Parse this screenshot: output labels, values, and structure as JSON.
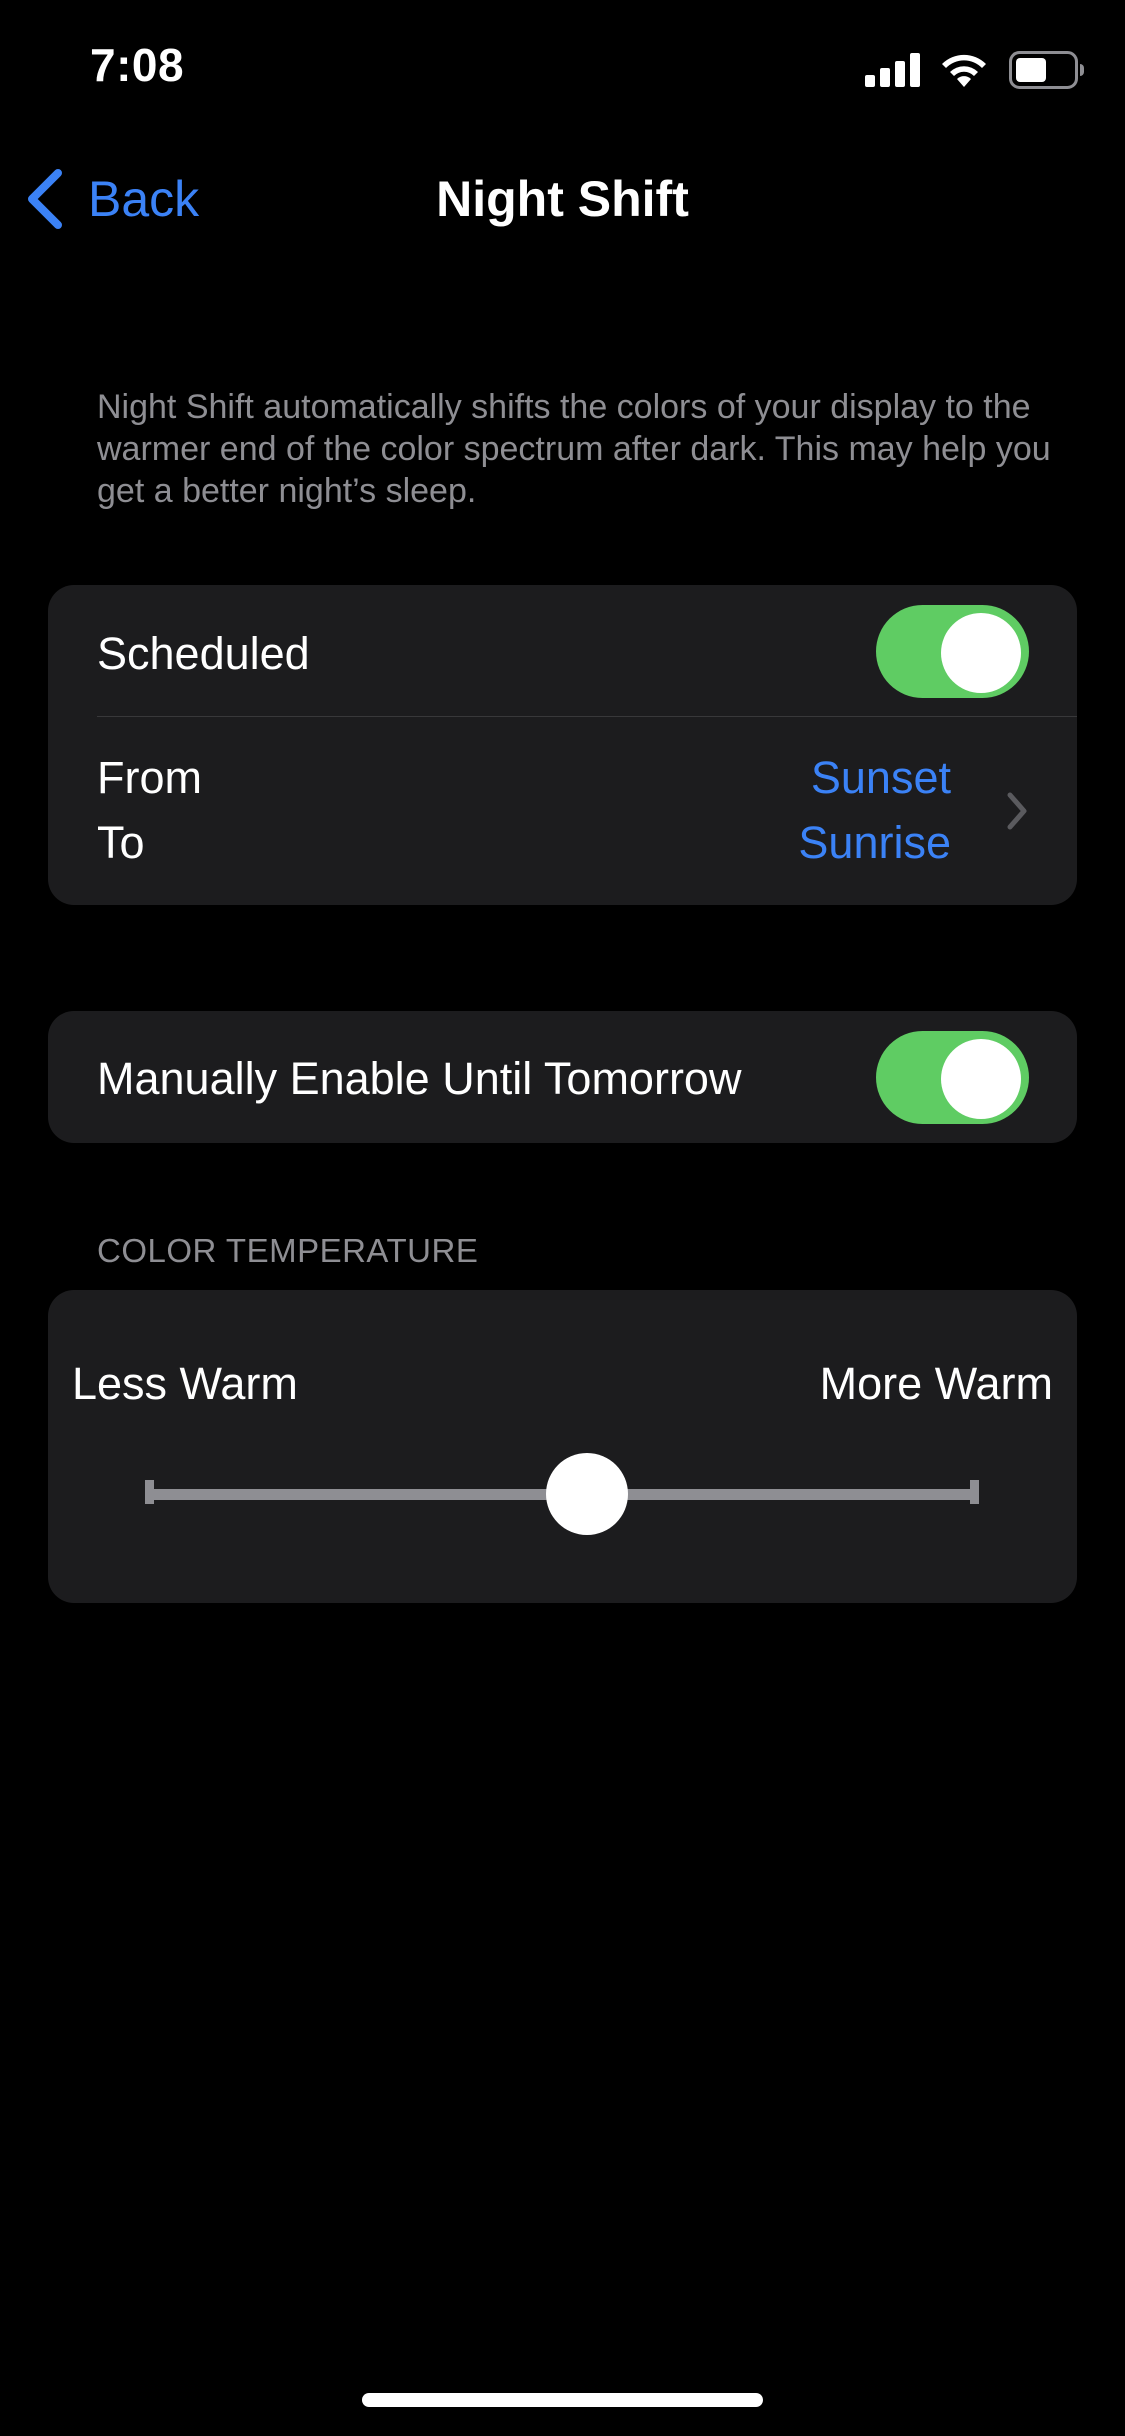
{
  "status_bar": {
    "time": "7:08",
    "icons": [
      "signal-icon",
      "wifi-icon",
      "battery-icon"
    ]
  },
  "nav": {
    "back_label": "Back",
    "title": "Night Shift"
  },
  "description": "Night Shift automatically shifts the colors of your display to the warmer end of the color spectrum after dark. This may help you get a better night’s sleep.",
  "schedule": {
    "scheduled_label": "Scheduled",
    "scheduled_on": true,
    "from_label": "From",
    "to_label": "To",
    "from_value": "Sunset",
    "to_value": "Sunrise"
  },
  "manual": {
    "label": "Manually Enable Until Tomorrow",
    "on": true
  },
  "color_temperature": {
    "section_header": "COLOR TEMPERATURE",
    "less_label": "Less Warm",
    "more_label": "More Warm",
    "value_fraction": 0.53
  },
  "colors": {
    "accent": "#3b82f6",
    "toggle_on": "#5fcc63",
    "card_bg": "#1c1c1e",
    "secondary_text": "#8e8e93",
    "background": "#000000"
  }
}
